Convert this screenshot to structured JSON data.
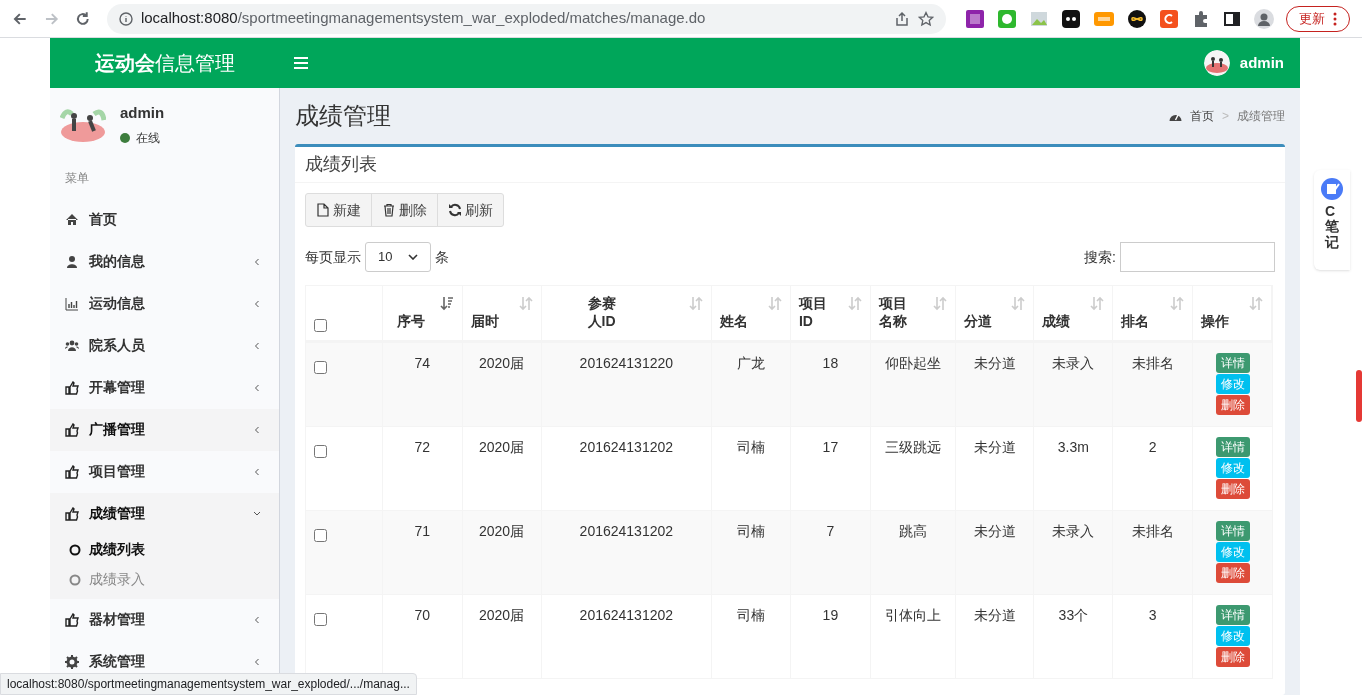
{
  "browser": {
    "url_host": "localhost:8080",
    "url_path": "/sportmeetingmanagementsystem_war_exploded/matches/manage.do",
    "update_button": "更新"
  },
  "header": {
    "logo_bold": "运动会",
    "logo_rest": "信息管理",
    "user": "admin"
  },
  "sidebar": {
    "user_name": "admin",
    "status": "在线",
    "menu_header": "菜单",
    "items": [
      {
        "label": "首页",
        "has_arrow": false,
        "hovered": false,
        "expanded": false
      },
      {
        "label": "我的信息",
        "has_arrow": true,
        "hovered": false,
        "expanded": false
      },
      {
        "label": "运动信息",
        "has_arrow": true,
        "hovered": false,
        "expanded": false
      },
      {
        "label": "院系人员",
        "has_arrow": true,
        "hovered": false,
        "expanded": false
      },
      {
        "label": "开幕管理",
        "has_arrow": true,
        "hovered": false,
        "expanded": false
      },
      {
        "label": "广播管理",
        "has_arrow": true,
        "hovered": true,
        "expanded": false
      },
      {
        "label": "项目管理",
        "has_arrow": true,
        "hovered": false,
        "expanded": false
      },
      {
        "label": "成绩管理",
        "has_arrow": true,
        "hovered": false,
        "expanded": true,
        "children": [
          {
            "label": "成绩列表",
            "selected": true
          },
          {
            "label": "成绩录入",
            "selected": false
          }
        ]
      },
      {
        "label": "器材管理",
        "has_arrow": true,
        "hovered": false,
        "expanded": false
      },
      {
        "label": "系统管理",
        "has_arrow": true,
        "hovered": false,
        "expanded": false
      }
    ]
  },
  "content": {
    "page_title": "成绩管理",
    "breadcrumb": [
      "首页",
      "成绩管理"
    ],
    "breadcrumb_separator": ">",
    "select_all_checked": false,
    "box_title": "成绩列表",
    "toolbar": [
      "新建",
      "删除",
      "刷新"
    ],
    "length_before": "每页显示",
    "page_size": "10",
    "length_after": "条",
    "search_label": "搜索:",
    "table": {
      "columns": [
        {
          "label": "序号",
          "sorted": true
        },
        {
          "label": "届时",
          "sorted": false
        },
        {
          "label": "参赛人ID",
          "sorted": false
        },
        {
          "label": "姓名",
          "sorted": false
        },
        {
          "label": "项目ID",
          "sorted": false
        },
        {
          "label": "项目名称",
          "sorted": false
        },
        {
          "label": "分道",
          "sorted": false
        },
        {
          "label": "成绩",
          "sorted": false
        },
        {
          "label": "排名",
          "sorted": false
        },
        {
          "label": "操作",
          "sorted": false
        }
      ],
      "rows": [
        {
          "checked": false,
          "cells": [
            "74",
            "2020届",
            "201624131220",
            "广龙",
            "18",
            "仰卧起坐",
            "未分道",
            "未录入",
            "未排名"
          ],
          "actions": [
            {
              "label": "详情",
              "kind": "info"
            },
            {
              "label": "修改",
              "kind": "edit"
            },
            {
              "label": "删除",
              "kind": "delete"
            }
          ]
        },
        {
          "checked": false,
          "cells": [
            "72",
            "2020届",
            "201624131202",
            "司楠",
            "17",
            "三级跳远",
            "未分道",
            "3.3m",
            "2"
          ],
          "actions": [
            {
              "label": "详情",
              "kind": "info"
            },
            {
              "label": "修改",
              "kind": "edit"
            },
            {
              "label": "删除",
              "kind": "delete"
            }
          ]
        },
        {
          "checked": false,
          "cells": [
            "71",
            "2020届",
            "201624131202",
            "司楠",
            "7",
            "跳高",
            "未分道",
            "未录入",
            "未排名"
          ],
          "actions": [
            {
              "label": "详情",
              "kind": "info"
            },
            {
              "label": "修改",
              "kind": "edit"
            },
            {
              "label": "删除",
              "kind": "delete"
            }
          ]
        },
        {
          "checked": false,
          "cells": [
            "70",
            "2020届",
            "201624131202",
            "司楠",
            "19",
            "引体向上",
            "未分道",
            "33个",
            "3"
          ],
          "actions": [
            {
              "label": "详情",
              "kind": "info"
            },
            {
              "label": "修改",
              "kind": "edit"
            },
            {
              "label": "删除",
              "kind": "delete"
            }
          ]
        }
      ]
    }
  },
  "side_widget": {
    "label": "C笔记"
  },
  "status_bar": "localhost:8080/sportmeetingmanagementsystem_war_exploded/.../manag..."
}
